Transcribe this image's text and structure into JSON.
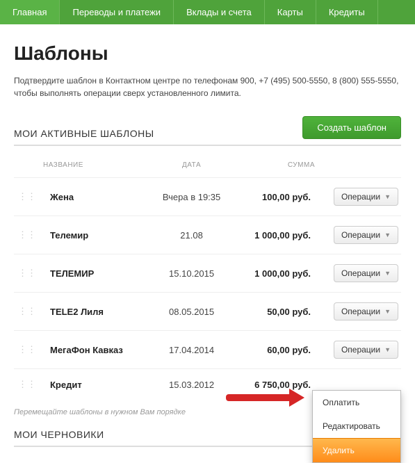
{
  "nav": [
    "Главная",
    "Переводы и платежи",
    "Вклады и счета",
    "Карты",
    "Кредиты"
  ],
  "page_title": "Шаблоны",
  "notice": "Подтвердите шаблон в Контактном центре по телефонам 900, +7 (495) 500-5550, 8 (800) 555-5550, чтобы выполнять операции сверх установленного лимита.",
  "active_section": "МОИ АКТИВНЫЕ ШАБЛОНЫ",
  "create_btn": "Создать шаблон",
  "columns": {
    "name": "НАЗВАНИЕ",
    "date": "ДАТА",
    "sum": "СУММА"
  },
  "ops_label": "Операции",
  "rows": [
    {
      "name": "Жена",
      "date": "Вчера в 19:35",
      "sum": "100,00 руб."
    },
    {
      "name": "Телемир",
      "date": "21.08",
      "sum": "1 000,00 руб."
    },
    {
      "name": "ТЕЛЕМИР",
      "date": "15.10.2015",
      "sum": "1 000,00 руб."
    },
    {
      "name": "TELE2 Лиля",
      "date": "08.05.2015",
      "sum": "50,00 руб."
    },
    {
      "name": "МегаФон Кавказ",
      "date": "17.04.2014",
      "sum": "60,00 руб."
    },
    {
      "name": "Кредит",
      "date": "15.03.2012",
      "sum": "6 750,00 руб."
    }
  ],
  "dropdown": {
    "pay": "Оплатить",
    "edit": "Редактировать",
    "delete": "Удалить"
  },
  "hint": "Перемещайте шаблоны в нужном Вам порядке",
  "drafts_section": "МОИ ЧЕРНОВИКИ"
}
